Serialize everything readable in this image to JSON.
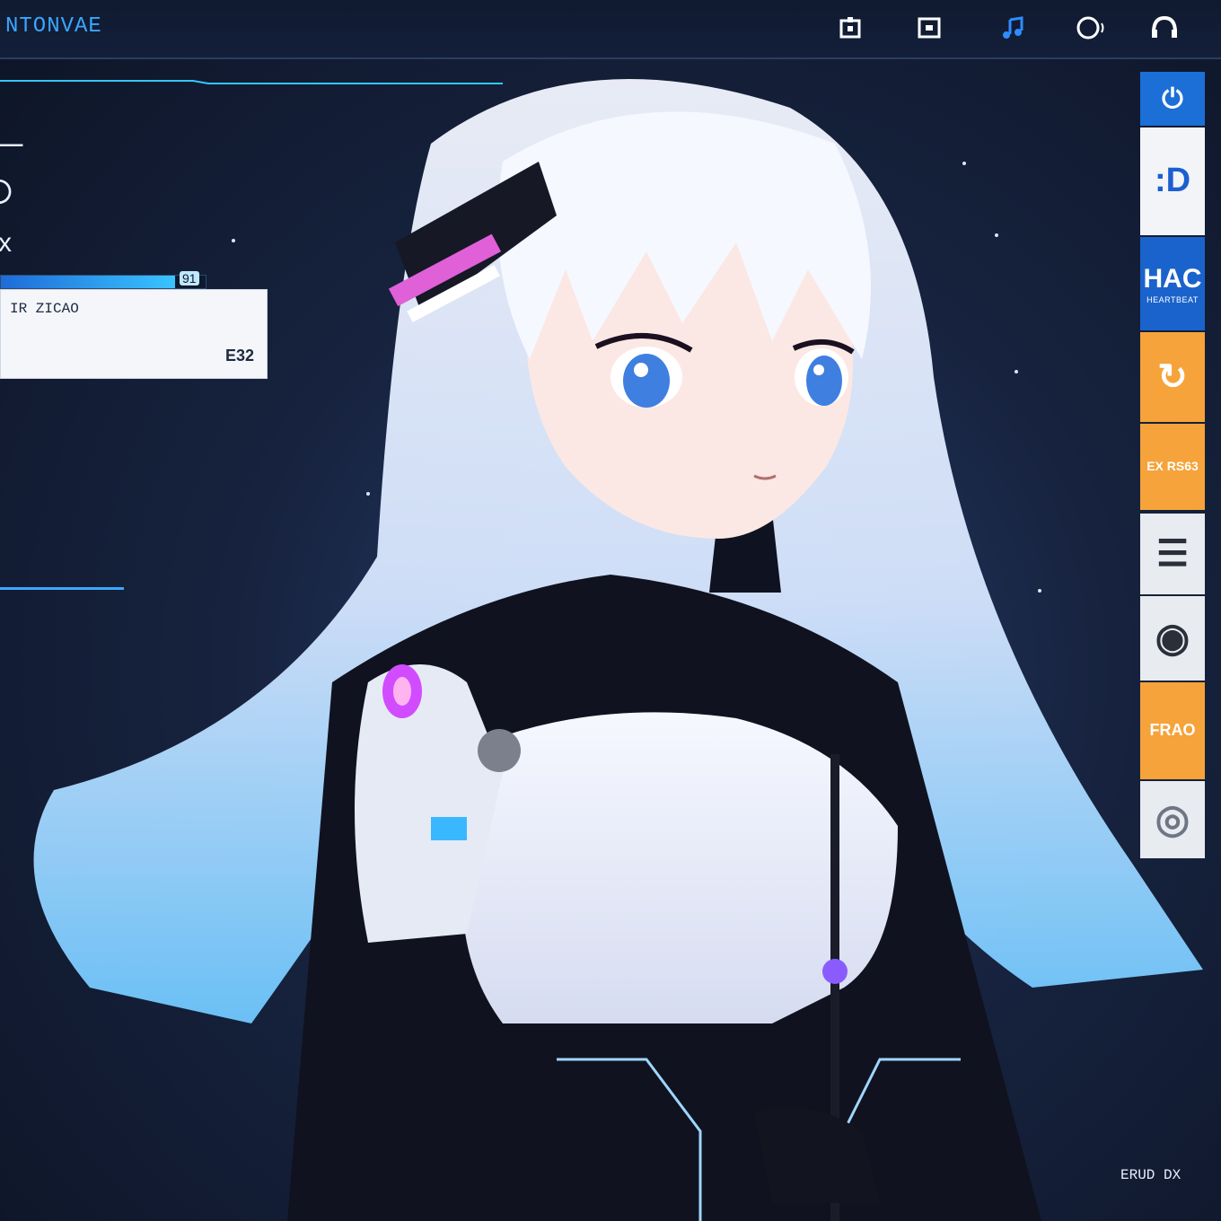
{
  "window": {
    "title": "NTONVAE"
  },
  "toolbar": {
    "icons": [
      "app-grid-icon",
      "window-icon",
      "music-note-icon",
      "search-icon",
      "headphones-icon"
    ]
  },
  "hud": {
    "glyph_top": "⊢",
    "glyph_circle": "○",
    "glyph_x": "x",
    "progress_label": "91",
    "progress_fraction": 0.85
  },
  "info_card": {
    "label": "IR  ZICAO",
    "value": "E32"
  },
  "sidebar": {
    "tiles": [
      {
        "name": "tile-power",
        "text": "⏻",
        "sub": "",
        "bg": "#1b6fd6",
        "fg": "#ffffff"
      },
      {
        "name": "tile-display",
        "text": ":D",
        "sub": "",
        "bg": "#f2f4f8",
        "fg": "#1c5fd0"
      },
      {
        "name": "tile-hac",
        "text": "HAC",
        "sub": "HEARTBEAT",
        "bg": "#1b63cc",
        "fg": "#ffffff"
      },
      {
        "name": "tile-refresh",
        "text": "↻",
        "sub": "",
        "bg": "#f5a33a",
        "fg": "#ffffff"
      },
      {
        "name": "tile-ex",
        "text": "EX RS63",
        "sub": "",
        "bg": "#f5a33a",
        "fg": "#ffffff"
      },
      {
        "name": "tile-menu",
        "text": "☰",
        "sub": "",
        "bg": "#e8ebf0",
        "fg": "#2a2f3a"
      },
      {
        "name": "tile-view",
        "text": "◉",
        "sub": "",
        "bg": "#e8ebf0",
        "fg": "#2a2f3a"
      },
      {
        "name": "tile-frao",
        "text": "FRAO",
        "sub": "",
        "bg": "#f5a33a",
        "fg": "#ffffff"
      },
      {
        "name": "tile-disc",
        "text": "◎",
        "sub": "",
        "bg": "#e8ebf0",
        "fg": "#6e7685"
      }
    ]
  },
  "footer": {
    "text": "ERUD DX"
  },
  "colors": {
    "accent": "#3aa7ff",
    "orange": "#f5a33a",
    "blue": "#1b6fd6",
    "background": "#17233f"
  }
}
